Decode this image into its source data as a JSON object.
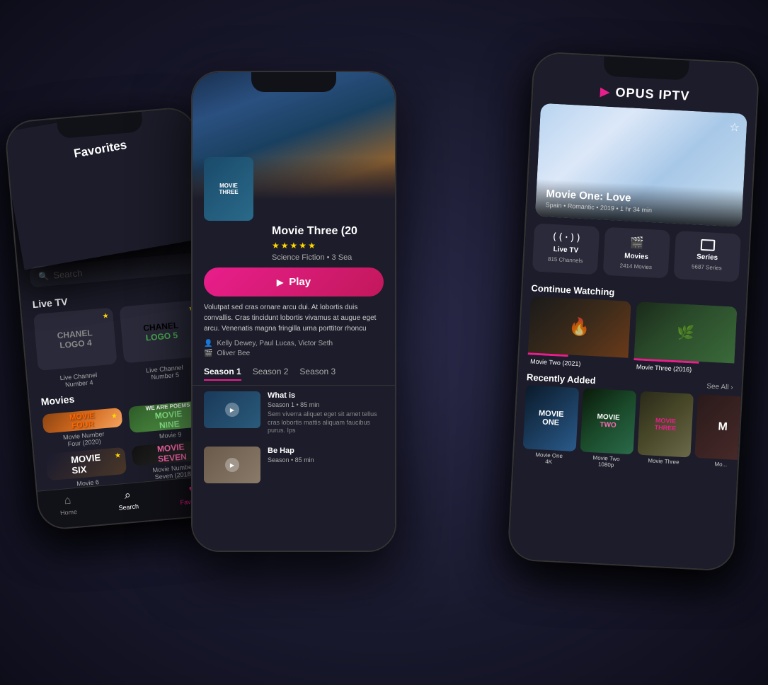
{
  "scene": {
    "bg": "#1a1a2e"
  },
  "phone_left": {
    "title": "Favorites",
    "search_placeholder": "Search",
    "sections": {
      "live_tv": "Live TV",
      "movies": "Movies"
    },
    "channels": [
      {
        "logo_line1": "CHANEL",
        "logo_line2": "LOGO 4",
        "label": "Live Channel\nNumber 4",
        "starred": true
      },
      {
        "logo_line1": "CHANEL",
        "logo_line2": "LOGO 5",
        "label": "Live Channel\nNumber 5",
        "starred": true
      }
    ],
    "movies": [
      {
        "title": "MOVIE FOUR",
        "label": "Movie Number\nFour (2020)",
        "starred": true
      },
      {
        "title": "MOVIE NINE",
        "sub": "Movie 9",
        "label": "Movie 9",
        "starred": true
      }
    ],
    "movies2": [
      {
        "title": "MOVIE SIX",
        "label": "Movie 6",
        "starred": true
      },
      {
        "title": "MOVIE SEVEN",
        "label": "Movie Number\nSeven (2018)",
        "starred": true
      }
    ],
    "nav": [
      {
        "icon": "⌂",
        "label": "Home",
        "active": false
      },
      {
        "icon": "⌕",
        "label": "Search",
        "active": true
      },
      {
        "icon": "♥",
        "label": "Favorites",
        "active_pink": true
      }
    ]
  },
  "phone_center": {
    "movie_title": "Movie Three (20",
    "thumb_text": "MOVIE\nTHREE",
    "rating_stars": 5,
    "genre": "Science Fiction • 3 Sea",
    "play_label": "Play",
    "description": "Volutpat sed cras ornare arcu dui. At lobortis duis convallis. Cras tincidunt lobortis vivamus at augue eget arcu. Venenatis magna fringilla urna porttitor rhoncu",
    "cast": "Kelly Dewey, Paul Lucas, Victor Seth",
    "director": "Oliver Bee",
    "seasons": [
      {
        "label": "Season 1",
        "active": true
      },
      {
        "label": "Season 2",
        "active": false
      },
      {
        "label": "Season 3",
        "active": false
      }
    ],
    "episodes": [
      {
        "title": "What is",
        "meta": "Season 1 • 85 min",
        "description": "Sem viverra aliquet eget sit amet tellus cras lobortis mattis aliquam faucibus purus. Ips"
      },
      {
        "title": "Be Hap",
        "meta": "Season • 85 min",
        "description": ""
      }
    ]
  },
  "phone_right": {
    "app_name": "OPUS IPTV",
    "featured": {
      "title": "Movie One: Love",
      "meta": "Spain • Romantic • 2019 • 1 hr 34 min",
      "starred": true
    },
    "categories": [
      {
        "icon": "((·))",
        "label": "Live TV",
        "count": "815 Channels"
      },
      {
        "icon": "🎬",
        "label": "Movies",
        "count": "2414 Movies"
      },
      {
        "icon": "⬜",
        "label": "Series",
        "count": "5687 Series"
      }
    ],
    "continue_watching": {
      "title": "Continue Watching",
      "items": [
        {
          "label": "Movie Two (2021)"
        },
        {
          "label": "Movie Three (2016)"
        }
      ]
    },
    "recently_added": {
      "title": "Recently Added",
      "see_all": "See All ›",
      "items": [
        {
          "title": "MOVIE\nONE",
          "label": "Movie One\n4K"
        },
        {
          "title": "MOVIE\nTWO",
          "label": "Movie Two\n1080p"
        },
        {
          "title": "MOVIE\nTHREE",
          "label": "Movie Three"
        },
        {
          "title": "M",
          "label": "Mo..."
        }
      ]
    }
  }
}
